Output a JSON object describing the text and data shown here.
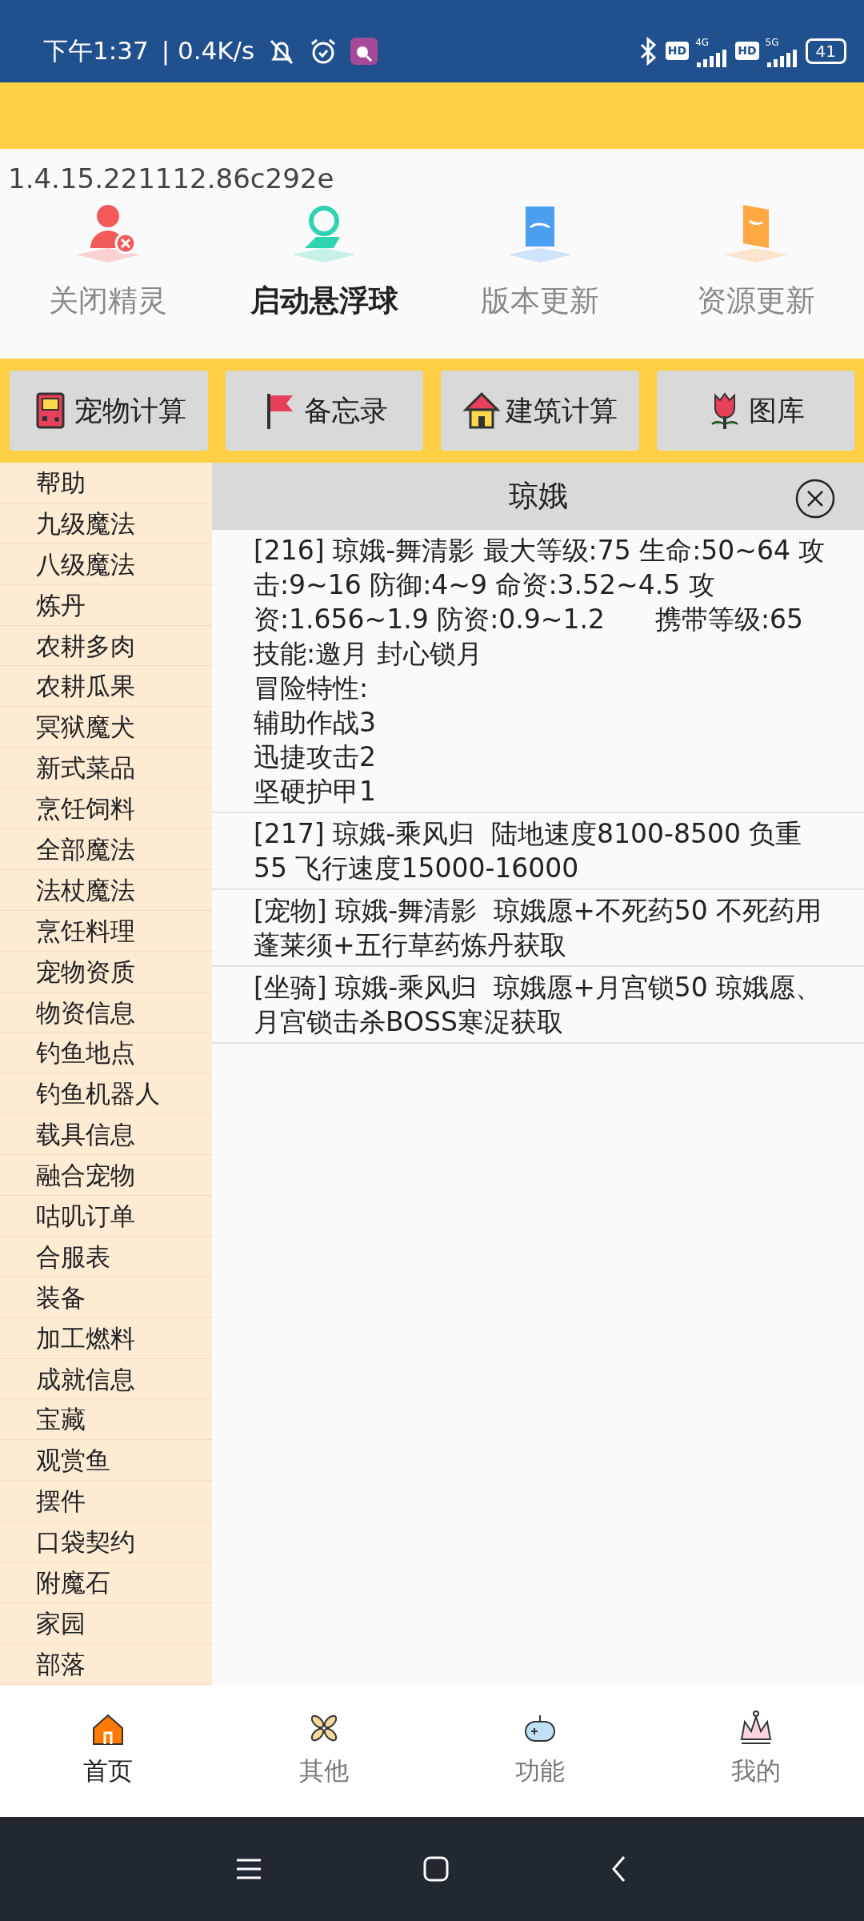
{
  "status_bar": {
    "time": "下午1:37",
    "speed": "| 0.4K/s",
    "signals": [
      {
        "hd": "HD",
        "gen": "4G"
      },
      {
        "hd": "HD",
        "gen": "5G"
      }
    ],
    "battery": "41"
  },
  "version": "1.4.15.221112.86c292e",
  "actions": [
    {
      "label": "关闭精灵",
      "kind": "person",
      "selected": false
    },
    {
      "label": "启动悬浮球",
      "kind": "hand",
      "selected": true
    },
    {
      "label": "版本更新",
      "kind": "folder",
      "selected": false
    },
    {
      "label": "资源更新",
      "kind": "box",
      "selected": false
    }
  ],
  "tools": [
    {
      "label": "宠物计算",
      "kind": "gameboy"
    },
    {
      "label": "备忘录",
      "kind": "flag"
    },
    {
      "label": "建筑计算",
      "kind": "house"
    },
    {
      "label": "图库",
      "kind": "flower"
    }
  ],
  "sidebar": {
    "items": [
      "帮助",
      "九级魔法",
      "八级魔法",
      "炼丹",
      "农耕多肉",
      "农耕瓜果",
      "冥狱魔犬",
      "新式菜品",
      "烹饪饲料",
      "全部魔法",
      "法杖魔法",
      "烹饪料理",
      "宠物资质",
      "物资信息",
      "钓鱼地点",
      "钓鱼机器人",
      "载具信息",
      "融合宠物",
      "咕叽订单",
      "合服表",
      "装备",
      "加工燃料",
      "成就信息",
      "宝藏",
      "观赏鱼",
      "摆件",
      "口袋契约",
      "附魔石",
      "家园",
      "部落"
    ]
  },
  "search": {
    "value": "琼娥"
  },
  "results": [
    {
      "lines": [
        "[216] 琼娥-舞清影 最大等级:75 生命:50~64 攻击:9~16 防御:4~9 命资:3.52~4.5 攻资:1.656~1.9 防资:0.9~1.2      携带等级:65  技能:邀月 封心锁月",
        "冒险特性:",
        "辅助作战3",
        "迅捷攻击2",
        "坚硬护甲1"
      ]
    },
    {
      "lines": [
        "[217] 琼娥-乘风归  陆地速度8100-8500 负重55 飞行速度15000-16000"
      ]
    },
    {
      "lines": [
        "[宠物] 琼娥-舞清影  琼娥愿+不死药50 不死药用蓬莱须+五行草药炼丹获取"
      ]
    },
    {
      "lines": [
        "[坐骑] 琼娥-乘风归  琼娥愿+月宫锁50 琼娥愿、月宫锁击杀BOSS寒浞获取"
      ]
    }
  ],
  "bottom_nav": [
    {
      "label": "首页",
      "kind": "home",
      "selected": true
    },
    {
      "label": "其他",
      "kind": "pinwheel",
      "selected": false
    },
    {
      "label": "功能",
      "kind": "gamepad",
      "selected": false
    },
    {
      "label": "我的",
      "kind": "crown",
      "selected": false
    }
  ]
}
